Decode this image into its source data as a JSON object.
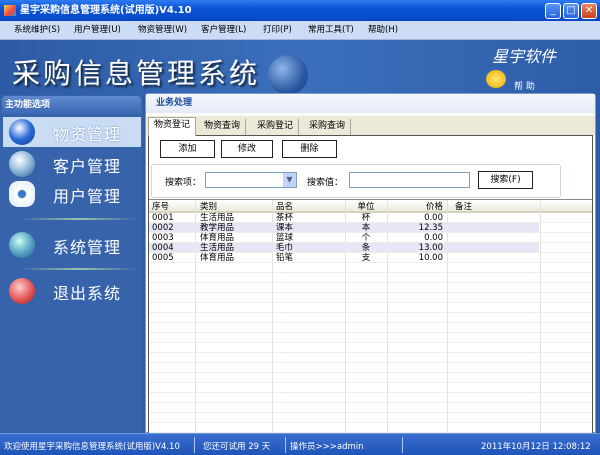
{
  "window": {
    "title": "星宇采购信息管理系统(试用版)V4.10",
    "minimize": "_",
    "maximize": "□",
    "close": "✕"
  },
  "menu": [
    "系统维护(S)",
    "用户管理(U)",
    "物资管理(W)",
    "客户管理(L)",
    "打印(P)",
    "常用工具(T)",
    "帮助(H)"
  ],
  "banner": {
    "title": "采购信息管理系统",
    "brand": "星宇软件",
    "help": "帮 助"
  },
  "sidebar": {
    "header": "主功能选项",
    "items": [
      {
        "label": "物资管理",
        "icon": "globe-icon",
        "active": true
      },
      {
        "label": "客户管理",
        "icon": "card-icon"
      },
      {
        "label": "用户管理",
        "icon": "gear-icon"
      },
      {
        "label": "系统管理",
        "icon": "network-icon"
      },
      {
        "label": "退出系统",
        "icon": "power-icon"
      }
    ]
  },
  "main": {
    "header": "业务处理",
    "tabs": [
      "物资登记",
      "物资查询",
      "采购登记",
      "采购查询"
    ],
    "active_tab": 0,
    "buttons": {
      "add": "添加",
      "edit": "修改",
      "delete": "删除"
    },
    "search": {
      "field_label": "搜索项：",
      "field_value": "",
      "value_label": "搜索值：",
      "value": "",
      "button": "搜索(F)"
    },
    "table": {
      "columns": [
        "序号",
        "类别",
        "品名",
        "单位",
        "价格",
        "备注"
      ],
      "rows": [
        [
          "0001",
          "生活用品",
          "茶杯",
          "杯",
          "0.00",
          ""
        ],
        [
          "0002",
          "教学用品",
          "课本",
          "本",
          "12.35",
          ""
        ],
        [
          "0003",
          "体育用品",
          "篮球",
          "个",
          "0.00",
          ""
        ],
        [
          "0004",
          "生活用品",
          "毛巾",
          "条",
          "13.00",
          ""
        ],
        [
          "0005",
          "体育用品",
          "铅笔",
          "支",
          "10.00",
          ""
        ]
      ]
    }
  },
  "status": {
    "welcome": "欢迎使用星宇采购信息管理系统(试用版)V4.10",
    "trial": "您还可试用 29 天",
    "operator": "操作员>>>admin",
    "datetime": "2011年10月12日 12:08:12"
  }
}
